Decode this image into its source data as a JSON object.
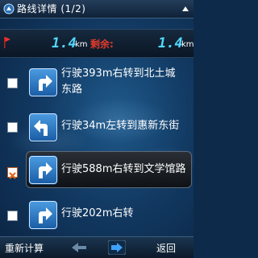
{
  "header": {
    "title": "路线详情 (1/2)"
  },
  "distance": {
    "value1": "1.4",
    "unit1": "km",
    "remaining_label": "剩余:",
    "value2": "1.4",
    "unit2": "km"
  },
  "steps": [
    {
      "text": "行驶393m右转到北土城东路",
      "turn": "right",
      "checked": false,
      "highlighted": false
    },
    {
      "text": "行驶34m左转到惠新东街",
      "turn": "left",
      "checked": false,
      "highlighted": false
    },
    {
      "text": "行驶588m右转到文学馆路",
      "turn": "right",
      "checked": true,
      "highlighted": true
    },
    {
      "text": "行驶202m右转",
      "turn": "right",
      "checked": false,
      "highlighted": false
    }
  ],
  "footer": {
    "recalc_label": "重新计算",
    "back_label": "返回"
  },
  "colors": {
    "accent": "#52d8ff",
    "remaining": "#e03a2a",
    "arrow_button": "#2f7bc8"
  }
}
